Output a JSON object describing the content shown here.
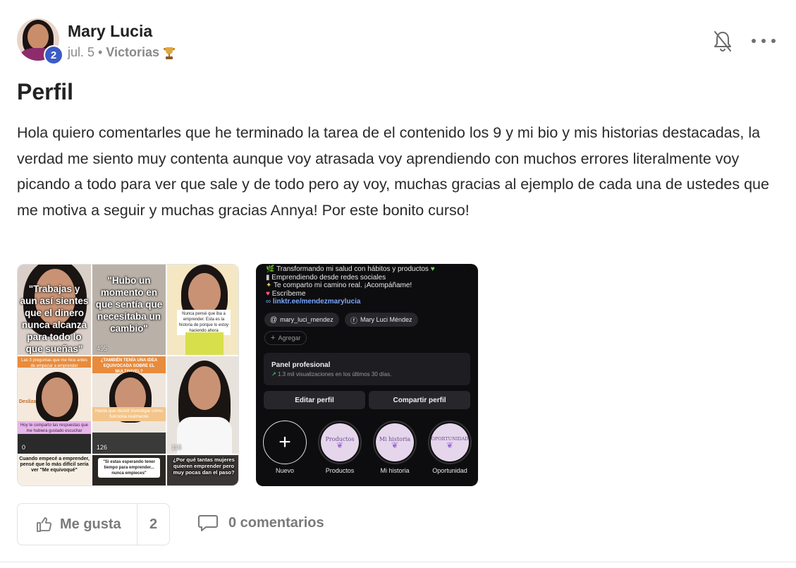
{
  "post": {
    "author": "Mary Lucia",
    "level": "2",
    "date": "jul. 5",
    "separator": "•",
    "group": "Victorias",
    "title": "Perfil",
    "body": "Hola quiero comentarles que he terminado la tarea de el contenido los 9 y mi bio y mis historias destacadas, la verdad me siento muy contenta aunque voy atrasada voy aprendiendo con muchos errores literalmente voy picando a todo para ver que sale y de todo pero ay voy, muchas gracias al ejemplo de cada una de ustedes que me motiva a seguir y muchas gracias Annya! Por este bonito curso!"
  },
  "actions": {
    "bell_icon": "bell-off-icon",
    "more_icon": "more-dots-icon",
    "like_label": "Me gusta",
    "like_count": "2",
    "comments_label": "0 comentarios"
  },
  "grid_captions": {
    "c1": "\"Trabajas y aun así sientes que el dinero nunca alcanza para todo lo que sueñas\"",
    "c2": "\"Hubo un momento en que sentía que necesitaba un cambio\"",
    "c2_views": "495",
    "c3": "Nunca pensé que iba a emprender. Esta es la historia de porque lo estoy haciendo ahora",
    "c4_top": "Las 3 preguntas que me hice antes de empezar a emprender",
    "c4_bottom": "Hoy te comparto las respuestas que me hubiera gustado escuchar",
    "c4_side": "Desliza",
    "c4_views": "0",
    "c5_top": "¿TAMBIÉN TENÍA UNA IDEA EQUIVOCADA SOBRE EL MULTINIVEL?",
    "c5_mid": "Hasta que decidí investigar cómo funciona realmente",
    "c5_views": "126",
    "c6_views": "115",
    "c7": "Cuando empecé a emprender, pensé que lo más difícil sería ver \"Me equivoqué\"",
    "c8": "\"Si estas esperando tener tiempo para emprender... nunca empieces\"",
    "c9": "¿Por qué tantas mujeres quieren emprender pero muy pocas dan el paso?"
  },
  "profile_mock": {
    "bio_lines": [
      "Transformando mi salud con hábitos y productos",
      "Emprendiendo desde redes sociales",
      "Te comparto mi camino real. ¡Acompáñame!",
      "Escríbeme"
    ],
    "bio_link": "linktr.ee/mendezmarylucia",
    "chip_threads": "mary_luci_mendez",
    "chip_facebook": "Mary Luci Méndez",
    "add_label": "Agregar",
    "panel_title": "Panel profesional",
    "panel_stat": "1.3 mil visualizaciones en los últimos 30 días.",
    "edit_btn": "Editar perfil",
    "share_btn": "Compartir perfil",
    "highlights": [
      {
        "label": "Nuevo",
        "art": "+"
      },
      {
        "label": "Productos",
        "art": "Productos"
      },
      {
        "label": "Mi historia",
        "art": "Mi historia"
      },
      {
        "label": "Oportunidad",
        "art": "OPORTUNIDAD"
      }
    ]
  }
}
